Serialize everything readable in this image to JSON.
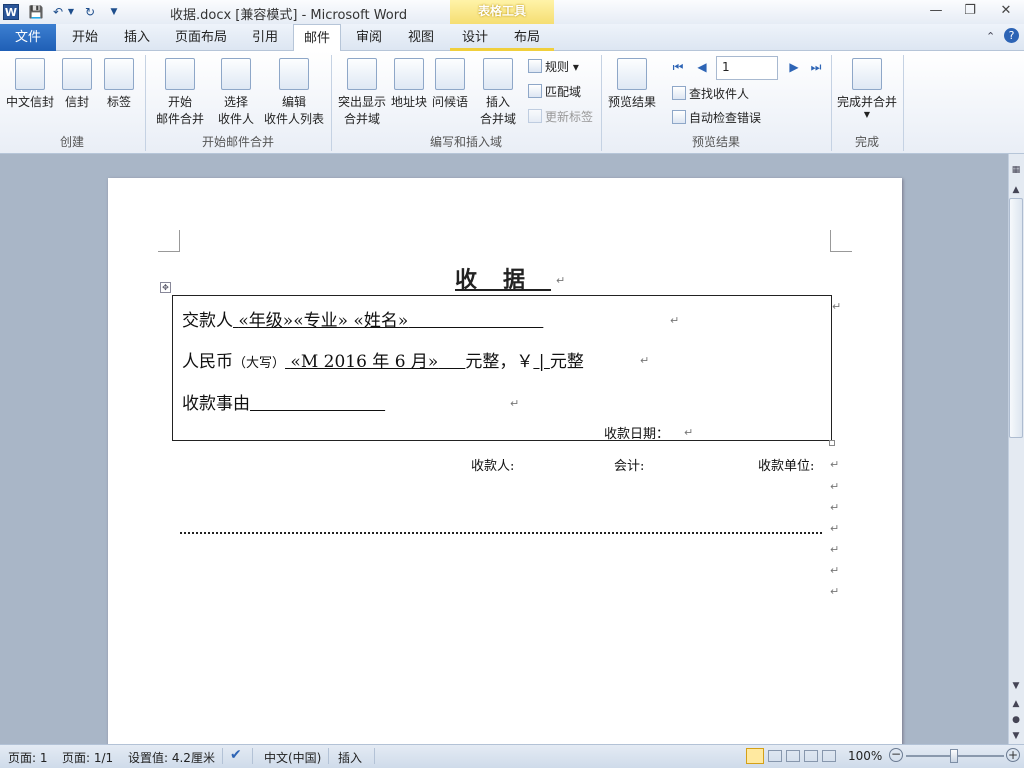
{
  "titlebar": {
    "title": "收据.docx [兼容模式] - Microsoft Word",
    "table_tools": "表格工具",
    "app_icon": "W"
  },
  "tabs": [
    "文件",
    "开始",
    "插入",
    "页面布局",
    "引用",
    "邮件",
    "审阅",
    "视图",
    "设计",
    "布局"
  ],
  "active_tab": "邮件",
  "ribbon": {
    "create": {
      "label": "创建",
      "chinese_envelope": "中文信封",
      "envelope": "信封",
      "labels": "标签"
    },
    "start_merge": {
      "label": "开始邮件合并",
      "start1": "开始",
      "start2": "邮件合并",
      "select1": "选择",
      "select2": "收件人",
      "edit1": "编辑",
      "edit2": "收件人列表"
    },
    "write_insert": {
      "label": "编写和插入域",
      "highlight1": "突出显示",
      "highlight2": "合并域",
      "address": "地址块",
      "greeting": "问候语",
      "insert1": "插入",
      "insert2": "合并域",
      "rules": "规则",
      "match": "匹配域",
      "update": "更新标签"
    },
    "preview": {
      "label": "预览结果",
      "preview_results": "预览结果",
      "record": "1",
      "find": "查找收件人",
      "check": "自动检查错误"
    },
    "finish": {
      "label": "完成",
      "finish_merge": "完成并合并"
    }
  },
  "document": {
    "title": "收据",
    "payer_label": "交款人",
    "payer_fields": "«年级»«专业» «姓名»",
    "rmb_label": "人民币",
    "rmb_note": "（大写）",
    "rmb_field": "«M 2016 年 6 月»",
    "yuan_whole": "元整，￥",
    "yuan_whole2": "元整",
    "reason_label": "收款事由",
    "date_label": "收款日期：",
    "receiver": "收款人:",
    "accountant": "会计:",
    "unit": "收款单位:"
  },
  "status": {
    "page": "页面: 1",
    "pages": "页面: 1/1",
    "setting": "设置值: 4.2厘米",
    "language": "中文(中国)",
    "mode": "插入",
    "zoom": "100%"
  }
}
